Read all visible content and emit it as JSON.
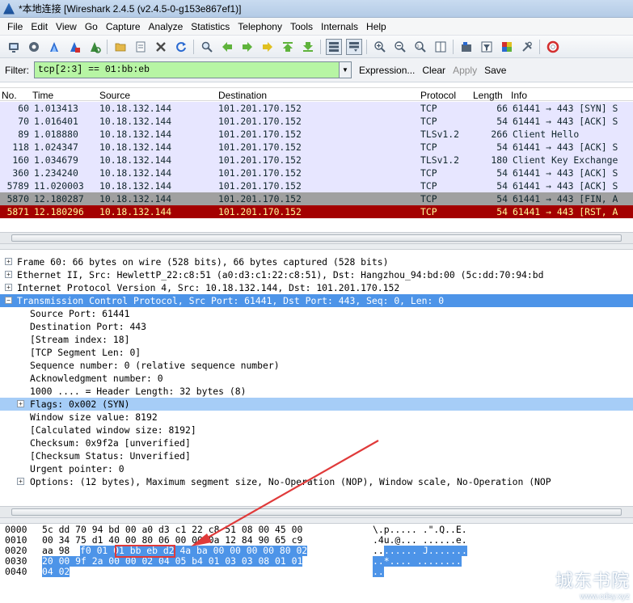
{
  "window": {
    "title": "*本地连接 [Wireshark 2.4.5 (v2.4.5-0-g153e867ef1)]"
  },
  "menu": [
    "File",
    "Edit",
    "View",
    "Go",
    "Capture",
    "Analyze",
    "Statistics",
    "Telephony",
    "Tools",
    "Internals",
    "Help"
  ],
  "toolbar": {
    "icons": [
      "interface-list-icon",
      "capture-options-icon",
      "start-capture-icon",
      "stop-capture-icon",
      "restart-capture-icon",
      "open-file-icon",
      "save-file-icon",
      "close-file-icon",
      "reload-icon",
      "find-packet-icon",
      "go-back-icon",
      "go-forward-icon",
      "go-to-packet-icon",
      "go-first-icon",
      "go-last-icon",
      "colorize-icon",
      "autoscroll-icon",
      "zoom-in-icon",
      "zoom-out-icon",
      "normal-size-icon",
      "resize-columns-icon",
      "capture-filters-icon",
      "display-filters-icon",
      "coloring-rules-icon",
      "preferences-icon",
      "help-icon"
    ]
  },
  "filter": {
    "label": "Filter:",
    "value": "tcp[2:3] == 01:bb:eb",
    "expression": "Expression...",
    "clear": "Clear",
    "apply": "Apply",
    "save": "Save",
    "bg_color": "#b7f5a4"
  },
  "packet_list": {
    "columns": [
      "No.",
      "Time",
      "Source",
      "Destination",
      "Protocol",
      "Length",
      "Info"
    ],
    "rows": [
      {
        "no": "60",
        "time": "1.013413",
        "src": "10.18.132.144",
        "dst": "101.201.170.152",
        "proto": "TCP",
        "len": "66",
        "info": "61441 → 443 [SYN] S",
        "bg": "#e7e6ff",
        "fg": "#12272e"
      },
      {
        "no": "70",
        "time": "1.016401",
        "src": "10.18.132.144",
        "dst": "101.201.170.152",
        "proto": "TCP",
        "len": "54",
        "info": "61441 → 443 [ACK] S",
        "bg": "#e7e6ff",
        "fg": "#12272e"
      },
      {
        "no": "89",
        "time": "1.018880",
        "src": "10.18.132.144",
        "dst": "101.201.170.152",
        "proto": "TLSv1.2",
        "len": "266",
        "info": "Client Hello",
        "bg": "#e7e6ff",
        "fg": "#12272e"
      },
      {
        "no": "118",
        "time": "1.024347",
        "src": "10.18.132.144",
        "dst": "101.201.170.152",
        "proto": "TCP",
        "len": "54",
        "info": "61441 → 443 [ACK] S",
        "bg": "#e7e6ff",
        "fg": "#12272e"
      },
      {
        "no": "160",
        "time": "1.034679",
        "src": "10.18.132.144",
        "dst": "101.201.170.152",
        "proto": "TLSv1.2",
        "len": "180",
        "info": "Client Key Exchange",
        "bg": "#e7e6ff",
        "fg": "#12272e"
      },
      {
        "no": "360",
        "time": "1.234240",
        "src": "10.18.132.144",
        "dst": "101.201.170.152",
        "proto": "TCP",
        "len": "54",
        "info": "61441 → 443 [ACK] S",
        "bg": "#e7e6ff",
        "fg": "#12272e"
      },
      {
        "no": "5789",
        "time": "11.020003",
        "src": "10.18.132.144",
        "dst": "101.201.170.152",
        "proto": "TCP",
        "len": "54",
        "info": "61441 → 443 [ACK] S",
        "bg": "#e7e6ff",
        "fg": "#12272e"
      },
      {
        "no": "5870",
        "time": "12.180287",
        "src": "10.18.132.144",
        "dst": "101.201.170.152",
        "proto": "TCP",
        "len": "54",
        "info": "61441 → 443 [FIN, A",
        "bg": "#a0a0a0",
        "fg": "#12272e"
      },
      {
        "no": "5871",
        "time": "12.180296",
        "src": "10.18.132.144",
        "dst": "101.201.170.152",
        "proto": "TCP",
        "len": "54",
        "info": "61441 → 443 [RST, A",
        "bg": "#a40000",
        "fg": "#fffc9c"
      }
    ]
  },
  "details": [
    {
      "text": "Frame 60: 66 bytes on wire (528 bits), 66 bytes captured (528 bits)",
      "level": 0,
      "expander": "+"
    },
    {
      "text": "Ethernet II, Src: HewlettP_22:c8:51 (a0:d3:c1:22:c8:51), Dst: Hangzhou_94:bd:00 (5c:dd:70:94:bd",
      "level": 0,
      "expander": "+"
    },
    {
      "text": "Internet Protocol Version 4, Src: 10.18.132.144, Dst: 101.201.170.152",
      "level": 0,
      "expander": "+"
    },
    {
      "text": "Transmission Control Protocol, Src Port: 61441, Dst Port: 443, Seq: 0, Len: 0",
      "level": 0,
      "expander": "−",
      "selected": true
    },
    {
      "text": "Source Port: 61441",
      "level": 1
    },
    {
      "text": "Destination Port: 443",
      "level": 1
    },
    {
      "text": "[Stream index: 18]",
      "level": 1
    },
    {
      "text": "[TCP Segment Len: 0]",
      "level": 1
    },
    {
      "text": "Sequence number: 0    (relative sequence number)",
      "level": 1
    },
    {
      "text": "Acknowledgment number: 0",
      "level": 1
    },
    {
      "text": "1000 .... = Header Length: 32 bytes (8)",
      "level": 1
    },
    {
      "text": "Flags: 0x002 (SYN)",
      "level": 1,
      "expander": "+",
      "highlight": true
    },
    {
      "text": "Window size value: 8192",
      "level": 1
    },
    {
      "text": "[Calculated window size: 8192]",
      "level": 1
    },
    {
      "text": "Checksum: 0x9f2a [unverified]",
      "level": 1
    },
    {
      "text": "[Checksum Status: Unverified]",
      "level": 1
    },
    {
      "text": "Urgent pointer: 0",
      "level": 1
    },
    {
      "text": "Options: (12 bytes), Maximum segment size, No-Operation (NOP), Window scale, No-Operation (NOP",
      "level": 1,
      "expander": "+"
    }
  ],
  "hex": [
    {
      "offset": "0000",
      "plain": "5c dd 70 94 bd 00 a0 d3 c1 22 c8 51 08 00 45 00",
      "ascii": "\\.p..... .\".Q..E."
    },
    {
      "offset": "0010",
      "plain": "00 34 75 d1 40 00 80 06 00 00 0a 12 84 90 65 c9",
      "ascii": ".4u.@... ......e."
    },
    {
      "offset": "0020",
      "pre": "aa 98 ",
      "sel": "f0 01 01 bb eb d2 4a ba 00 00 00 00 80 02",
      "ascii_pre": "..",
      "ascii_sel": "...... J.......",
      "ascii": "..…… J……."
    },
    {
      "offset": "0030",
      "sel": "20 00 9f 2a 00 00 02 04 05 b4 01 03 03 08 01 01",
      "ascii_sel": " ..*.... ........",
      "ascii": " ..*.... …….."
    },
    {
      "offset": "0040",
      "sel": "04 02",
      "ascii_sel": "..",
      "ascii": ".."
    }
  ],
  "watermark": {
    "line1": "城东书院",
    "line2": "www.cdsy.xyz"
  }
}
